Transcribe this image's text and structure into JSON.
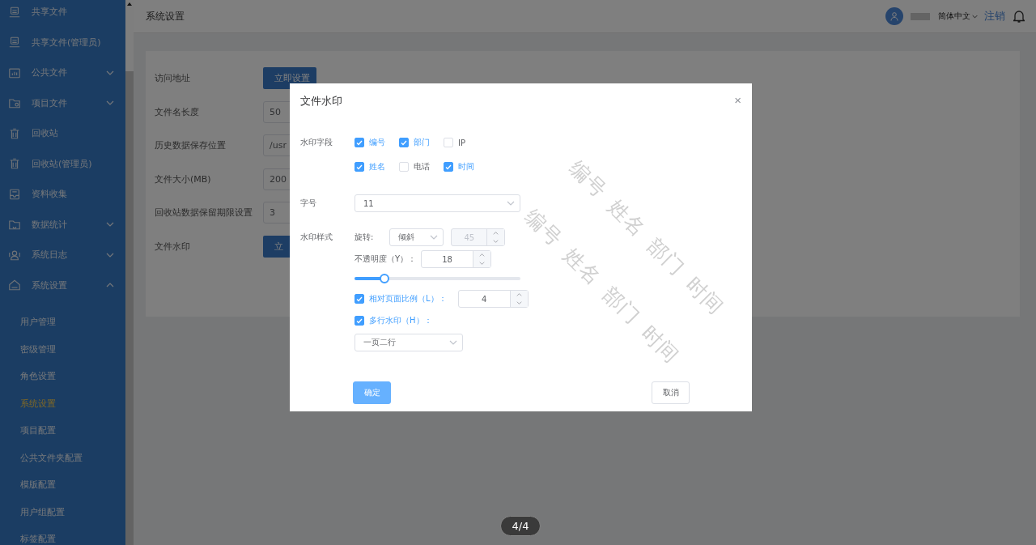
{
  "sidebar": {
    "items": [
      {
        "label": "共享文件",
        "kind": "link"
      },
      {
        "label": "共享文件(管理员)",
        "kind": "link"
      },
      {
        "label": "公共文件",
        "kind": "group",
        "expanded": false
      },
      {
        "label": "项目文件",
        "kind": "group",
        "expanded": false
      },
      {
        "label": "回收站",
        "kind": "link"
      },
      {
        "label": "回收站(管理员)",
        "kind": "link"
      },
      {
        "label": "资料收集",
        "kind": "link"
      },
      {
        "label": "数据统计",
        "kind": "group",
        "expanded": false
      },
      {
        "label": "系统日志",
        "kind": "group",
        "expanded": false
      },
      {
        "label": "系统设置",
        "kind": "group",
        "expanded": true,
        "children": [
          {
            "label": "用户管理",
            "selected": false
          },
          {
            "label": "密级管理",
            "selected": false
          },
          {
            "label": "角色设置",
            "selected": false
          },
          {
            "label": "系统设置",
            "selected": true
          },
          {
            "label": "项目配置",
            "selected": false
          },
          {
            "label": "公共文件夹配置",
            "selected": false
          },
          {
            "label": "模版配置",
            "selected": false
          },
          {
            "label": "用户组配置",
            "selected": false
          },
          {
            "label": "标签配置",
            "selected": false
          }
        ]
      }
    ]
  },
  "header": {
    "title": "系统设置",
    "language": "简体中文",
    "logout": "注销"
  },
  "settings": {
    "rows": [
      {
        "label": "访问地址",
        "kind": "button",
        "value": "立即设置"
      },
      {
        "label": "文件名长度",
        "kind": "input",
        "value": "50"
      },
      {
        "label": "历史数据保存位置",
        "kind": "input",
        "value": "/usr"
      },
      {
        "label": "文件大小(MB)",
        "kind": "input",
        "value": "200"
      },
      {
        "label": "回收站数据保留期限设置",
        "kind": "input",
        "value": "3"
      },
      {
        "label": "文件水印",
        "kind": "button",
        "value": "立"
      }
    ]
  },
  "dialog": {
    "title": "文件水印",
    "close": "×",
    "fields_label": "水印字段",
    "fields": [
      {
        "label": "编号",
        "checked": true
      },
      {
        "label": "部门",
        "checked": true
      },
      {
        "label": "IP",
        "checked": false
      },
      {
        "label": "姓名",
        "checked": true
      },
      {
        "label": "电话",
        "checked": false
      },
      {
        "label": "时间",
        "checked": true
      }
    ],
    "size_label": "字号",
    "size": "11",
    "style_label": "水印样式",
    "rotation_label": "旋转:",
    "rotation": "倾斜",
    "angle": {
      "value": "45",
      "disabled": true
    },
    "opacity_label": "不透明度（Y）：",
    "opacity": "18",
    "opacity_slider": {
      "level": 0.18
    },
    "scale": {
      "label": "相对页面比例（L）：",
      "checked": true,
      "value": "4"
    },
    "multiline": {
      "label": "多行水印（H）：",
      "checked": true,
      "value": "一页二行"
    },
    "preview": [
      [
        "编号",
        "姓名",
        "部门",
        "时间"
      ],
      [
        "编号",
        "姓名",
        "部门",
        "时间"
      ]
    ],
    "buttons": [
      {
        "label": "确定",
        "kind": "primary"
      },
      {
        "label": "取消",
        "kind": "default"
      }
    ]
  },
  "page_counter": "4/4"
}
